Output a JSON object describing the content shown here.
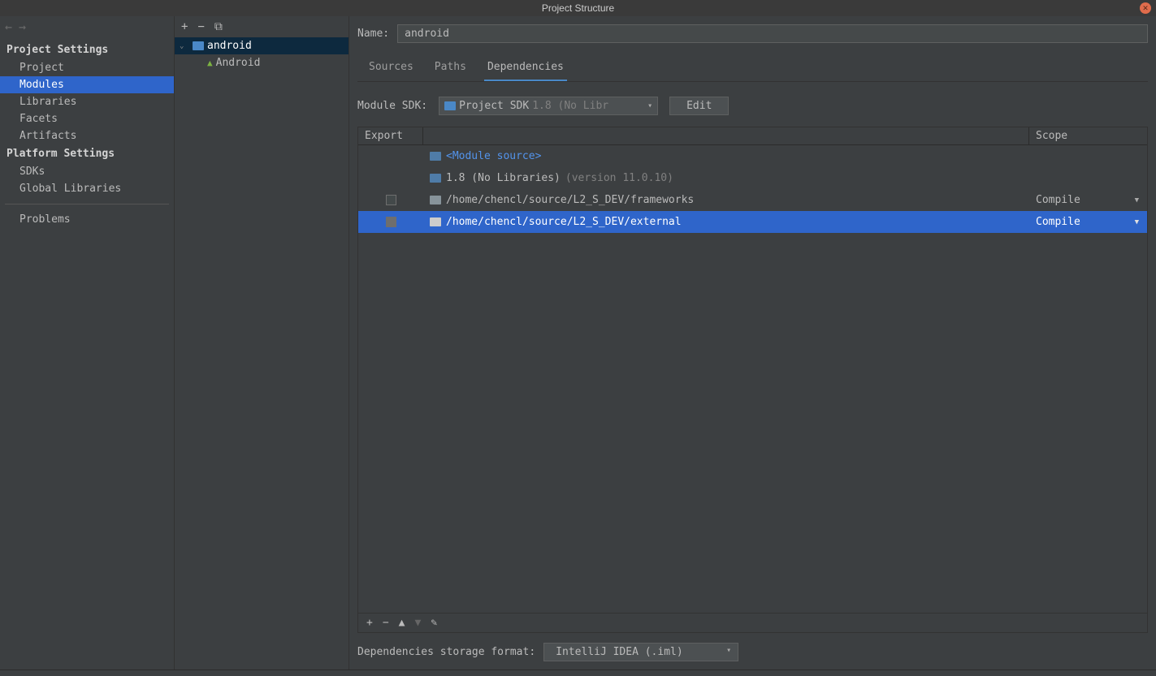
{
  "window": {
    "title": "Project Structure"
  },
  "sidebar": {
    "sections": [
      {
        "heading": "Project Settings",
        "items": [
          "Project",
          "Modules",
          "Libraries",
          "Facets",
          "Artifacts"
        ],
        "selected": 1
      },
      {
        "heading": "Platform Settings",
        "items": [
          "SDKs",
          "Global Libraries"
        ]
      }
    ],
    "problems": "Problems"
  },
  "modules": {
    "root": {
      "name": "android",
      "expanded": true,
      "selected": true
    },
    "children": [
      {
        "name": "Android"
      }
    ]
  },
  "content": {
    "name_label": "Name:",
    "name_value": "android",
    "tabs": [
      "Sources",
      "Paths",
      "Dependencies"
    ],
    "active_tab": 2,
    "sdk_label": "Module SDK:",
    "sdk_value": "Project SDK",
    "sdk_dim": "1.8 (No Libr",
    "edit_label": "Edit",
    "table": {
      "headers": {
        "export": "Export",
        "scope": "Scope"
      },
      "rows": [
        {
          "type": "source",
          "name": "<Module source>"
        },
        {
          "type": "jdk",
          "name": "1.8 (No Libraries)",
          "version": "(version 11.0.10)"
        },
        {
          "type": "dir",
          "export": false,
          "name": "/home/chencl/source/L2_S_DEV/frameworks",
          "scope": "Compile"
        },
        {
          "type": "dir",
          "export": true,
          "name": "/home/chencl/source/L2_S_DEV/external",
          "scope": "Compile",
          "selected": true
        }
      ]
    },
    "storage_label": "Dependencies storage format:",
    "storage_value": "IntelliJ IDEA (.iml)"
  }
}
